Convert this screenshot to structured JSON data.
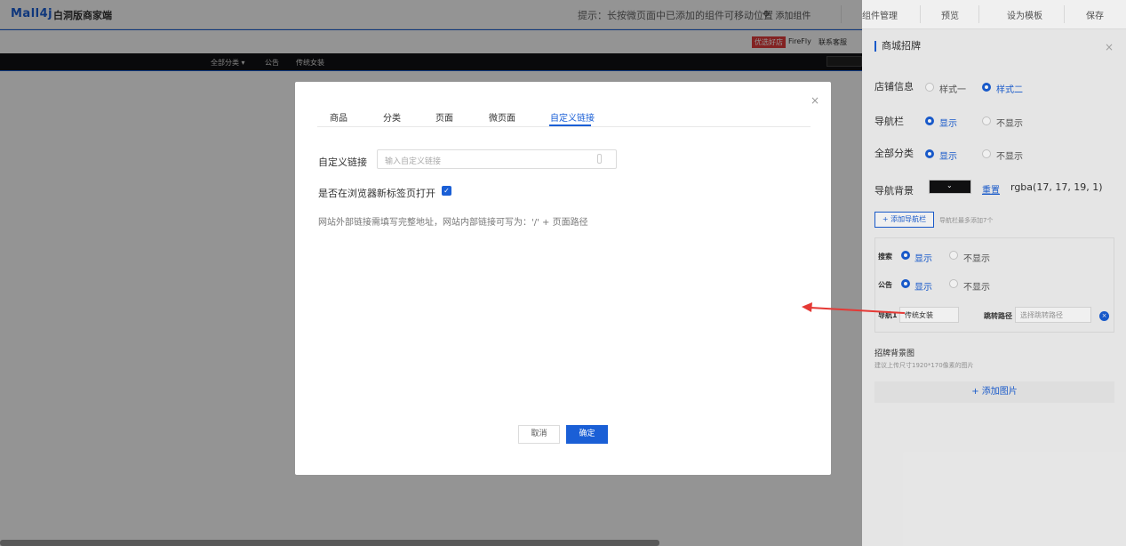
{
  "header": {
    "logo": "Mall4j",
    "logo_sub": "白洞版商家端",
    "hint": "提示：长按微页面中已添加的组件可移动位置",
    "add_component": "添加组件",
    "tabs": [
      "组件管理",
      "预览",
      "设为模板",
      "保存"
    ]
  },
  "preview": {
    "shop_badge": "优选好店",
    "shop_name": "FireFly",
    "contact": "联系客服",
    "nav_items": [
      "全部分类 ▾",
      "公告",
      "传统女装"
    ]
  },
  "panel": {
    "title": "商城招牌",
    "close": "×",
    "shop_info": {
      "label": "店铺信息",
      "options": [
        "样式一",
        "样式二"
      ],
      "selected": 1
    },
    "nav_bar": {
      "label": "导航栏",
      "options": [
        "显示",
        "不显示"
      ],
      "selected": 0
    },
    "all_category": {
      "label": "全部分类",
      "options": [
        "显示",
        "不显示"
      ],
      "selected": 0
    },
    "nav_bg": {
      "label": "导航背景",
      "color": "#111113",
      "reset": "重置",
      "value": "rgba(17, 17, 19, 1)"
    },
    "add_nav_button": "+ 添加导航栏",
    "add_nav_hint": "导航栏最多添加7个",
    "search": {
      "label": "搜索",
      "options": [
        "显示",
        "不显示"
      ],
      "selected": 0
    },
    "notice": {
      "label": "公告",
      "options": [
        "显示",
        "不显示"
      ],
      "selected": 0
    },
    "nav1": {
      "label": "导航1",
      "value": "传统女装",
      "path_label": "跳转路径",
      "path_placeholder": "选择跳转路径"
    },
    "bg_image_title": "招牌背景图",
    "bg_image_hint": "建议上传尺寸1920*170像素的图片",
    "add_image": "+ 添加图片"
  },
  "modal": {
    "tabs": [
      "商品",
      "分类",
      "页面",
      "微页面",
      "自定义链接"
    ],
    "active_tab": 4,
    "field_label": "自定义链接",
    "input_placeholder": "输入自定义链接",
    "newtab_label": "是否在浏览器新标签页打开",
    "newtab_checked": true,
    "tip": "网站外部链接需填写完整地址，网站内部链接可写为：'/' + 页面路径",
    "cancel": "取消",
    "ok": "确定",
    "close": "×"
  },
  "colors": {
    "accent": "#1a5fd6",
    "badge": "#e23b3b",
    "arrow": "#e53935"
  }
}
